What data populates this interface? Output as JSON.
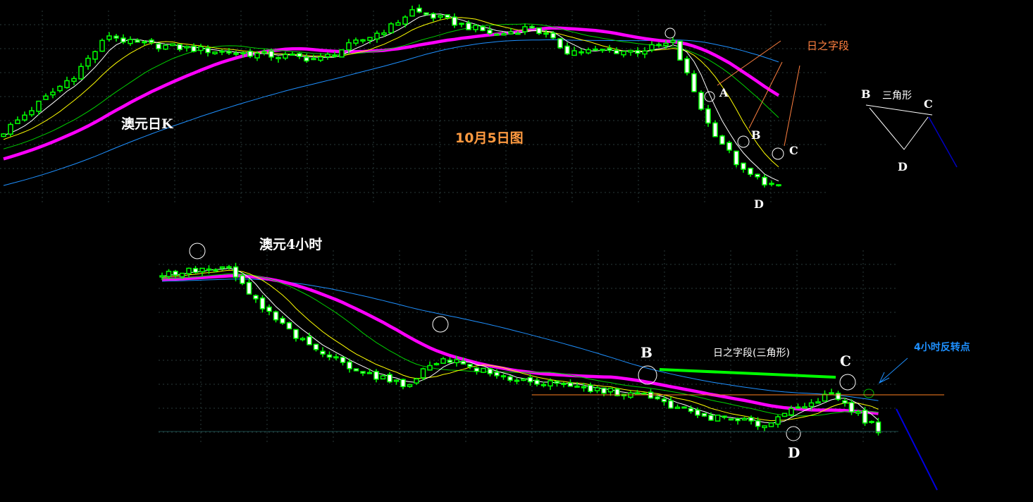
{
  "chart_data": [
    {
      "type": "candlestick",
      "title": "澳元日K",
      "subtitle": "10月5日图",
      "timeframe": "daily",
      "grid": true,
      "ylim": [
        0.68,
        0.8
      ],
      "close_keypoints": [
        [
          -60,
          0.66
        ],
        [
          -30,
          0.69
        ],
        [
          0,
          0.725
        ],
        [
          10,
          0.76
        ],
        [
          15,
          0.785
        ],
        [
          18,
          0.78
        ],
        [
          30,
          0.775
        ],
        [
          45,
          0.77
        ],
        [
          55,
          0.79
        ],
        [
          58,
          0.8
        ],
        [
          70,
          0.785
        ],
        [
          75,
          0.79
        ],
        [
          80,
          0.775
        ],
        [
          90,
          0.775
        ],
        [
          95,
          0.78
        ],
        [
          100,
          0.73
        ],
        [
          105,
          0.7
        ],
        [
          110,
          0.69
        ]
      ],
      "moving_averages": [
        {
          "name": "MA5",
          "period": 5,
          "color": "#ffffff"
        },
        {
          "name": "MA10",
          "period": 10,
          "color": "#ffff00"
        },
        {
          "name": "MA20",
          "period": 20,
          "color": "#00d000"
        },
        {
          "name": "MA30",
          "period": 30,
          "color": "#ff00ff"
        },
        {
          "name": "MA60",
          "period": 60,
          "color": "#1e90ff"
        }
      ],
      "annotations": {
        "points": [
          "A",
          "B",
          "C",
          "D"
        ],
        "wave_label": "日之字段",
        "pattern_label": "三角形",
        "pattern_points": [
          "B",
          "C",
          "D"
        ]
      }
    },
    {
      "type": "candlestick",
      "title": "澳元4小时",
      "timeframe": "4h",
      "grid": true,
      "ylim": [
        0.7,
        0.74
      ],
      "close_keypoints": [
        [
          -60,
          0.733
        ],
        [
          -10,
          0.734
        ],
        [
          0,
          0.735
        ],
        [
          6,
          0.736
        ],
        [
          10,
          0.736
        ],
        [
          15,
          0.728
        ],
        [
          22,
          0.72
        ],
        [
          30,
          0.715
        ],
        [
          36,
          0.712
        ],
        [
          42,
          0.718
        ],
        [
          50,
          0.714
        ],
        [
          60,
          0.712
        ],
        [
          72,
          0.71
        ],
        [
          80,
          0.706
        ],
        [
          90,
          0.704
        ],
        [
          95,
          0.708
        ],
        [
          100,
          0.71
        ],
        [
          104,
          0.706
        ],
        [
          107,
          0.703
        ]
      ],
      "moving_averages": [
        {
          "name": "MA5",
          "period": 5,
          "color": "#ffffff"
        },
        {
          "name": "MA10",
          "period": 10,
          "color": "#ffff00"
        },
        {
          "name": "MA20",
          "period": 20,
          "color": "#00d000"
        },
        {
          "name": "MA30",
          "period": 30,
          "color": "#ff00ff"
        },
        {
          "name": "MA60",
          "period": 60,
          "color": "#1e90ff"
        }
      ],
      "annotations": {
        "points": [
          "B",
          "C",
          "D"
        ],
        "wave_label": "日之字段(三角形)",
        "reversal_label": "4小时反转点"
      }
    }
  ],
  "labels": {
    "daily_title": "澳元日K",
    "daily_date": "10月5日图",
    "daily_wave": "日之字段",
    "daily_A": "A",
    "daily_B": "B",
    "daily_C": "C",
    "daily_D": "D",
    "tri_B": "B",
    "tri_C": "C",
    "tri_D": "D",
    "tri_label": "三角形",
    "h4_title": "澳元4小时",
    "h4_B": "B",
    "h4_C": "C",
    "h4_D": "D",
    "h4_wave": "日之字段(三角形)",
    "h4_reversal": "4小时反转点"
  },
  "colors": {
    "up": "#00ff00",
    "down_fill": "#ffffff",
    "orange": "#ff8040",
    "reversal": "#1e90ff"
  }
}
